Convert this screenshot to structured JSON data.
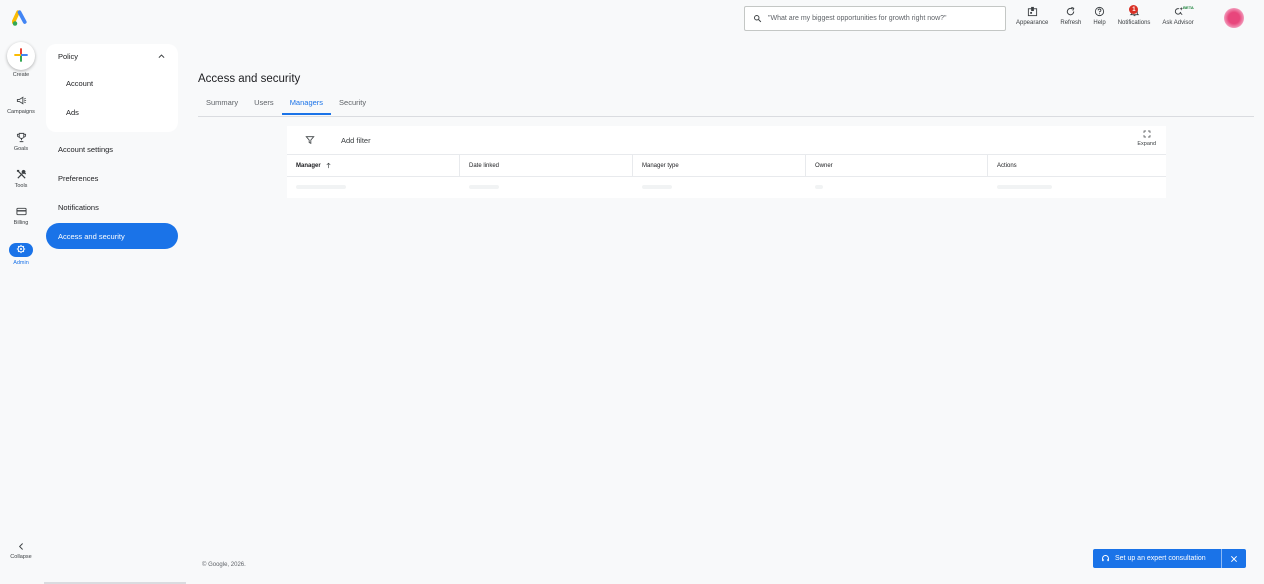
{
  "search": {
    "placeholder": "\"What are my biggest opportunities for growth right now?\""
  },
  "top_actions": {
    "appearance": "Appearance",
    "refresh": "Refresh",
    "help": "Help",
    "notifications": "Notifications",
    "notifications_count": "1",
    "ask_advisor": "Ask Advisor",
    "beta": "BETA"
  },
  "rail": {
    "create": "Create",
    "campaigns": "Campaigns",
    "goals": "Goals",
    "tools": "Tools",
    "billing": "Billing",
    "admin": "Admin",
    "collapse": "Collapse"
  },
  "subnav": {
    "policy": "Policy",
    "policy_items": [
      "Account",
      "Ads"
    ],
    "items": [
      "Account settings",
      "Preferences",
      "Notifications",
      "Access and security"
    ]
  },
  "main": {
    "title": "Access and security",
    "tabs": [
      "Summary",
      "Users",
      "Managers",
      "Security"
    ],
    "active_tab": "Managers",
    "add_filter": "Add filter",
    "expand": "Expand",
    "columns": [
      "Manager",
      "Date linked",
      "Manager type",
      "Owner",
      "Actions"
    ]
  },
  "footer": {
    "copyright": "© Google, 2026."
  },
  "consultation": {
    "label": "Set up an expert consultation"
  },
  "colors": {
    "accent": "#1a73e8",
    "badge": "#d93025",
    "beta": "#188038"
  }
}
